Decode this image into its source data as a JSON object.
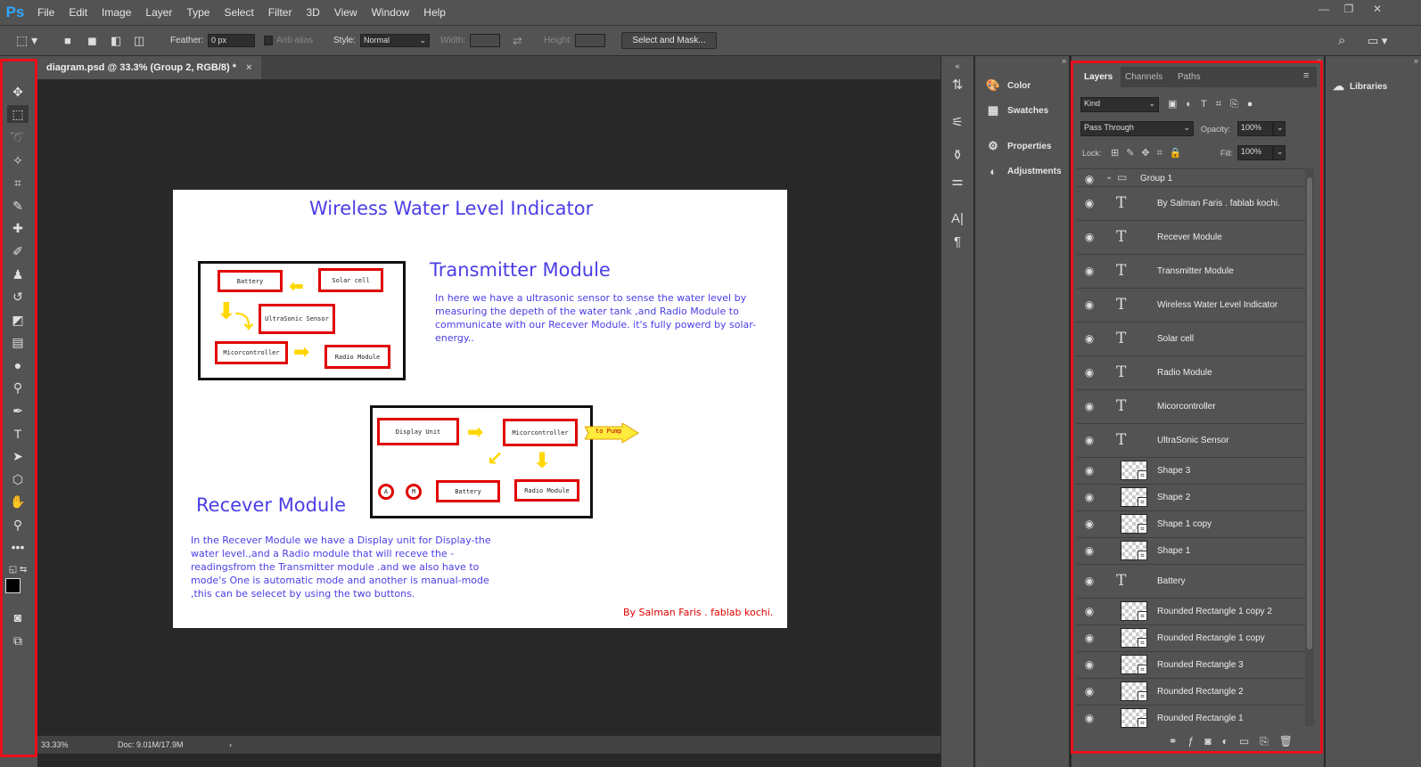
{
  "app": {
    "logo": "Ps"
  },
  "menu": [
    "File",
    "Edit",
    "Image",
    "Layer",
    "Type",
    "Select",
    "Filter",
    "3D",
    "View",
    "Window",
    "Help"
  ],
  "window_controls": {
    "minimize": "—",
    "restore": "❐",
    "close": "✕"
  },
  "options": {
    "feather_label": "Feather:",
    "feather_value": "0 px",
    "antialias_label": "Anti-alias",
    "style_label": "Style:",
    "style_value": "Normal",
    "width_label": "Width:",
    "height_label": "Height:",
    "select_mask_label": "Select and Mask..."
  },
  "document": {
    "tab_title": "diagram.psd @ 33.3% (Group 2, RGB/8) *",
    "tab_close": "×",
    "zoom": "33.33%",
    "doc_size": "Doc: 9.01M/17.9M"
  },
  "canvas": {
    "title": "Wireless Water Level Indicator",
    "transmitter_heading": "Transmitter Module",
    "transmitter_text": "In here we have a ultrasonic sensor to sense the water level by measuring the depeth of the water tank ,and Radio Module to communicate with our Recever Module. it's fully powerd by solar-energy..",
    "receiver_heading": "Recever Module",
    "receiver_text": "In the Recever Module we have a Display unit for Display-the water level.,and a Radio module that will receve the -readingsfrom the Transmitter module .and we also have to mode's One is automatic mode and another is manual-mode ,this can be selecet by using the two buttons.",
    "credit": "By Salman Faris . fablab kochi.",
    "tx_boxes": {
      "battery": "Battery",
      "solar": "Solar cell",
      "ultrasonic": "UltraSonic Sensor",
      "micro": "Micorcontroller",
      "radio": "Radio Module"
    },
    "rx_boxes": {
      "display": "Display Unit",
      "micro": "Micorcontroller",
      "battery": "Battery",
      "radio": "Radio Module",
      "pump": "to Pump",
      "btn_a": "A",
      "btn_m": "M"
    }
  },
  "side_panel": [
    {
      "label": "Color",
      "icon": "color-icon"
    },
    {
      "label": "Swatches",
      "icon": "swatches-icon"
    },
    {
      "label": "Properties",
      "icon": "properties-icon"
    },
    {
      "label": "Adjustments",
      "icon": "adjustments-icon"
    }
  ],
  "layers_panel": {
    "tabs": [
      "Layers",
      "Channels",
      "Paths"
    ],
    "filter": "Kind",
    "blend_mode": "Pass Through",
    "opacity_label": "Opacity:",
    "opacity_value": "100%",
    "lock_label": "Lock:",
    "fill_label": "Fill:",
    "fill_value": "100%",
    "group_name": "Group 1",
    "layers": [
      {
        "name": "By Salman Faris . fablab kochi.",
        "type": "text"
      },
      {
        "name": "Recever Module",
        "type": "text"
      },
      {
        "name": "Transmitter Module",
        "type": "text"
      },
      {
        "name": "Wireless Water Level Indicator",
        "type": "text"
      },
      {
        "name": "Solar cell",
        "type": "text"
      },
      {
        "name": "Radio Module",
        "type": "text"
      },
      {
        "name": "Micorcontroller",
        "type": "text"
      },
      {
        "name": "UltraSonic Sensor",
        "type": "text"
      },
      {
        "name": "Shape 3",
        "type": "shape"
      },
      {
        "name": "Shape 2",
        "type": "shape"
      },
      {
        "name": "Shape 1 copy",
        "type": "shape"
      },
      {
        "name": "Shape 1",
        "type": "shape"
      },
      {
        "name": "Battery",
        "type": "text"
      },
      {
        "name": "Rounded Rectangle 1 copy 2",
        "type": "shape"
      },
      {
        "name": "Rounded Rectangle 1 copy",
        "type": "shape"
      },
      {
        "name": "Rounded Rectangle 3",
        "type": "shape"
      },
      {
        "name": "Rounded Rectangle 2",
        "type": "shape"
      },
      {
        "name": "Rounded Rectangle 1",
        "type": "shape"
      }
    ]
  },
  "libraries": {
    "label": "Libraries"
  },
  "highlight_color": "#e8101a"
}
